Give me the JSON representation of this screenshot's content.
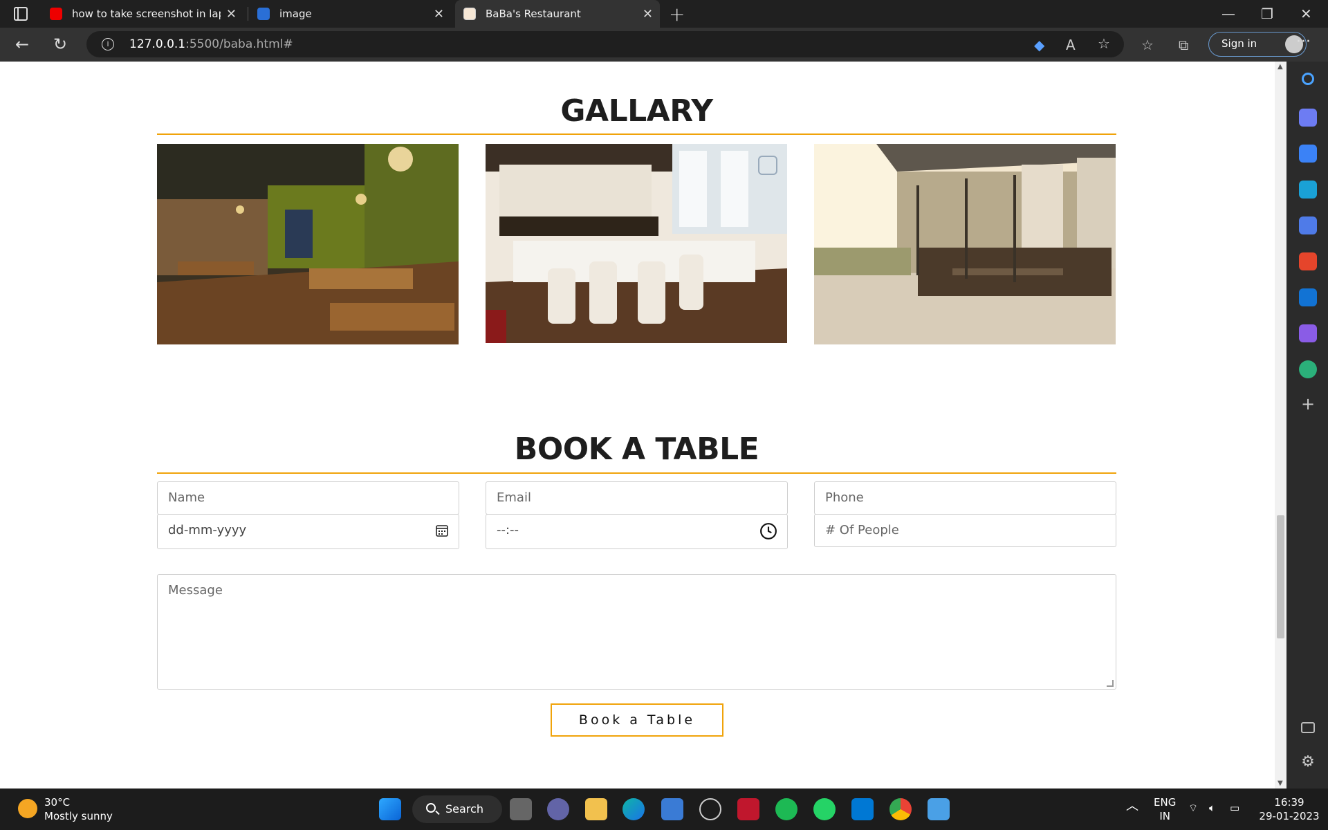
{
  "browser": {
    "tabs": [
      {
        "title": "how to take screenshot in laptop",
        "icon": "youtube-icon"
      },
      {
        "title": "image",
        "icon": "website-icon"
      },
      {
        "title": "BaBa's Restaurant",
        "icon": "page-icon",
        "active": true
      }
    ],
    "url_host": "127.0.0.1",
    "url_rest": ":5500/baba.html#",
    "signin_label": "Sign in"
  },
  "gallery": {
    "title": "GALLARY",
    "images": [
      {
        "alt": "warm lit restaurant interior with wooden tables"
      },
      {
        "alt": "restaurant with white leather chairs and booth seating"
      },
      {
        "alt": "outdoor terrace with wicker chairs"
      }
    ]
  },
  "booking": {
    "title": "BOOK A TABLE",
    "name_placeholder": "Name",
    "email_placeholder": "Email",
    "phone_placeholder": "Phone",
    "date_placeholder": "dd-mm-yyyy",
    "time_placeholder": "--:--",
    "people_placeholder": "# Of People",
    "message_placeholder": "Message",
    "submit_label": "Book a Table"
  },
  "taskbar": {
    "weather_temp": "30°C",
    "weather_desc": "Mostly sunny",
    "search_label": "Search",
    "lang_1": "ENG",
    "lang_2": "IN",
    "time": "16:39",
    "date": "29-01-2023"
  },
  "colors": {
    "accent": "#f0a30a"
  }
}
